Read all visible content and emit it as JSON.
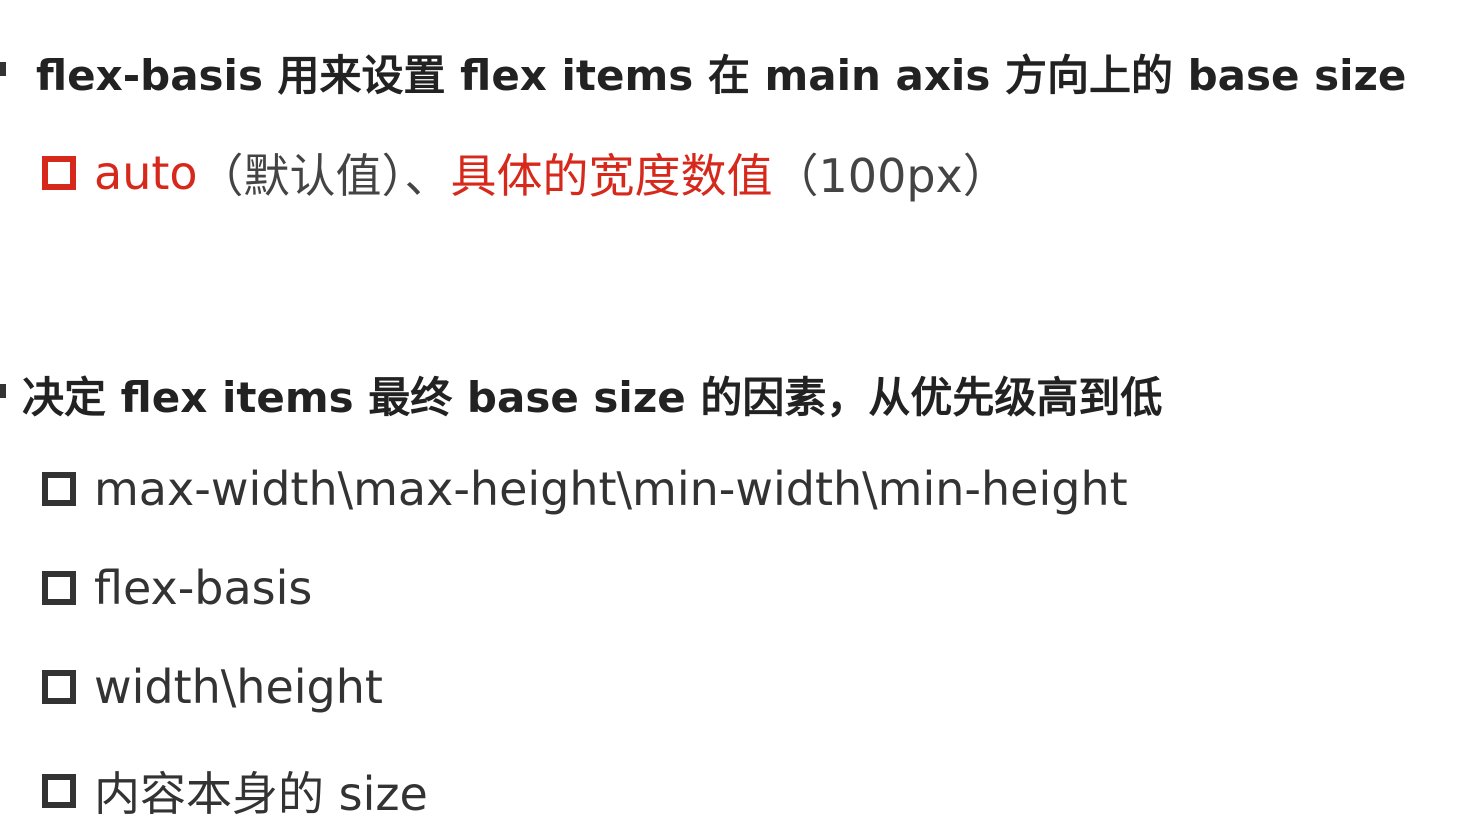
{
  "section1": {
    "heading": "flex-basis 用来设置 flex items 在 main axis 方向上的 base size",
    "values": {
      "auto": "auto",
      "auto_note": "（默认值）、",
      "specific": "具体的宽度数值",
      "specific_note": "（100px）"
    }
  },
  "section2": {
    "heading": "决定 flex items 最终 base size 的因素，从优先级高到低",
    "items": [
      "max-width\\max-height\\min-width\\min-height",
      "flex-basis",
      "width\\height",
      "内容本身的 size"
    ]
  },
  "colors": {
    "accent_red": "#d6281b",
    "text": "#222222"
  }
}
